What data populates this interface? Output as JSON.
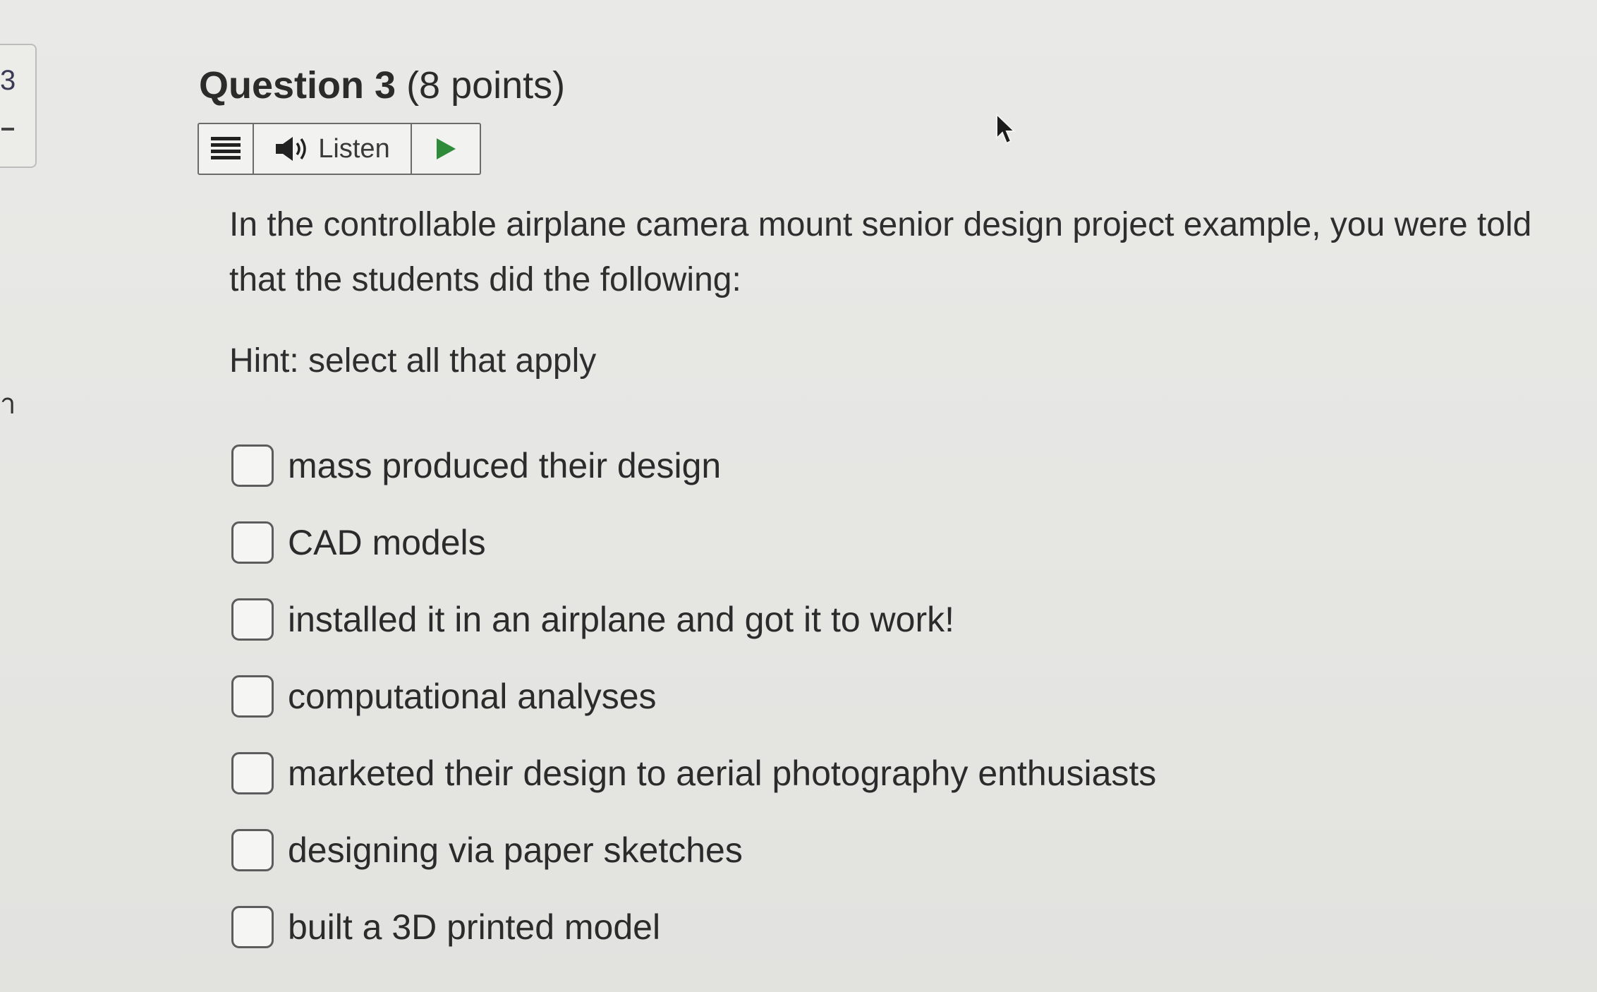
{
  "sidebar": {
    "number": "3",
    "mark": "–",
    "partial_char": "า"
  },
  "question": {
    "label": "Question 3",
    "points": "(8 points)",
    "text": "In the controllable airplane camera mount senior design project example, you were told that the students did the following:",
    "hint": "Hint: select all that apply"
  },
  "toolbar": {
    "menu_icon": "menu-lines-icon",
    "speaker_icon": "speaker-icon",
    "listen_label": "Listen",
    "play_icon": "play-icon",
    "play_color": "#2e8b3a"
  },
  "options": [
    {
      "label": "mass produced their design",
      "checked": false
    },
    {
      "label": "CAD models",
      "checked": false
    },
    {
      "label": "installed it in an airplane and got it to work!",
      "checked": false
    },
    {
      "label": "computational analyses",
      "checked": false
    },
    {
      "label": "marketed their design to aerial photography enthusiasts",
      "checked": false
    },
    {
      "label": "designing via paper sketches",
      "checked": false
    },
    {
      "label": "built a 3D printed model",
      "checked": false
    }
  ]
}
